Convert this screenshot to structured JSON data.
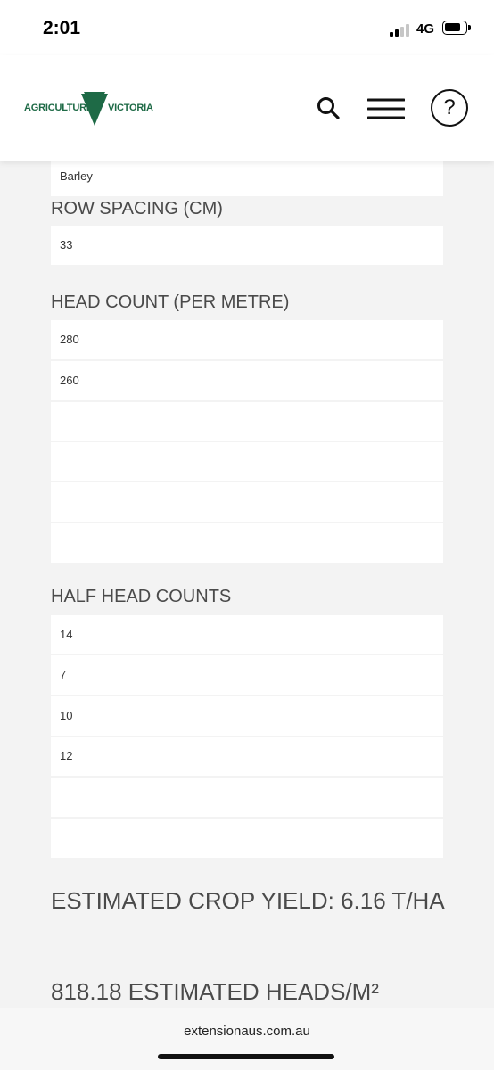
{
  "status_bar": {
    "time": "2:01",
    "network": "4G"
  },
  "header": {
    "logo_part1": "AGRICULTURE",
    "logo_part2": "VICTORIA",
    "brand_color": "#1e6a46",
    "icons": [
      "search-icon",
      "menu-icon",
      "help-icon"
    ],
    "help_label": "?"
  },
  "form": {
    "crop_value": "Barley",
    "row_spacing": {
      "label": "ROW SPACING (CM)",
      "value": "33"
    },
    "head_count": {
      "label": "HEAD COUNT (PER METRE)",
      "values": [
        "280",
        "260",
        "",
        "",
        "",
        ""
      ]
    },
    "half_head_counts": {
      "label": "HALF HEAD COUNTS",
      "values": [
        "14",
        "7",
        "10",
        "12",
        "",
        ""
      ]
    }
  },
  "results": {
    "yield": "ESTIMATED CROP YIELD: 6.16 T/HA",
    "heads": "818.18 ESTIMATED HEADS/M²"
  },
  "browser": {
    "url": "extensionaus.com.au"
  }
}
